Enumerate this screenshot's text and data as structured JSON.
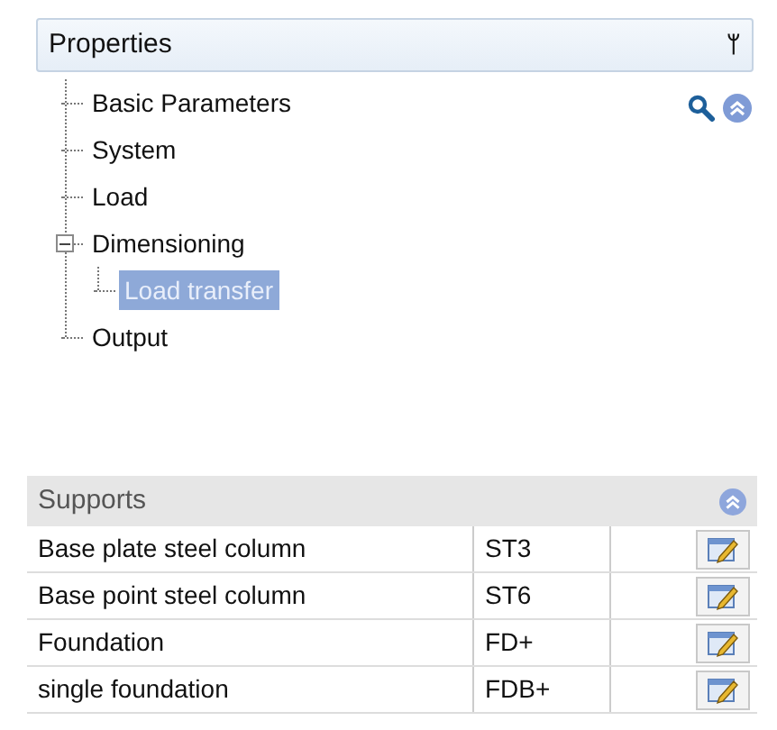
{
  "properties_panel": {
    "title": "Properties",
    "pin": "ᛘ",
    "tree": [
      {
        "label": "Basic Parameters",
        "selected": false
      },
      {
        "label": "System",
        "selected": false
      },
      {
        "label": "Load",
        "selected": false
      },
      {
        "label": "Dimensioning",
        "selected": false,
        "expanded": true,
        "children": [
          {
            "label": "Load transfer",
            "selected": true
          }
        ]
      },
      {
        "label": "Output",
        "selected": false
      }
    ]
  },
  "supports": {
    "title": "Supports",
    "rows": [
      {
        "name": "Base plate steel column",
        "code": "ST3"
      },
      {
        "name": "Base point steel column",
        "code": "ST6"
      },
      {
        "name": "Foundation",
        "code": "FD+"
      },
      {
        "name": "single foundation",
        "code": "FDB+"
      }
    ]
  }
}
